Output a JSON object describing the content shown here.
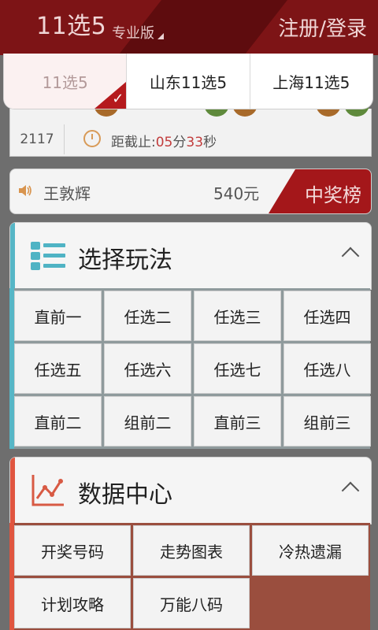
{
  "header": {
    "title": "11选5",
    "subtitle": "专业版",
    "login_label": "注册/登录"
  },
  "dropdown": {
    "options": [
      {
        "label": "11选5",
        "selected": true
      },
      {
        "label": "山东11选5",
        "selected": false
      },
      {
        "label": "上海11选5",
        "selected": false
      }
    ],
    "check_glyph": "✓"
  },
  "result": {
    "issue": "2117",
    "countdown_prefix": "距截止:",
    "minutes": "05",
    "min_unit": "分",
    "seconds": "33",
    "sec_unit": "秒"
  },
  "winner": {
    "name": "王敦辉",
    "amount": "540元",
    "tag": "中奖榜"
  },
  "play_section": {
    "title": "选择玩法",
    "accent_color": "#56b6c6",
    "items": [
      "直前一",
      "任选二",
      "任选三",
      "任选四",
      "任选五",
      "任选六",
      "任选七",
      "任选八",
      "直前二",
      "组前二",
      "直前三",
      "组前三"
    ]
  },
  "data_section": {
    "title": "数据中心",
    "accent_color": "#e0553f",
    "items": [
      "开奖号码",
      "走势图表",
      "冷热遗漏",
      "计划攻略",
      "万能八码"
    ]
  },
  "icons": {
    "list": "list-icon",
    "chart": "trend-chart-icon",
    "speaker": "speaker-icon",
    "clock": "clock-icon",
    "chevron": "chevron-up-icon"
  }
}
